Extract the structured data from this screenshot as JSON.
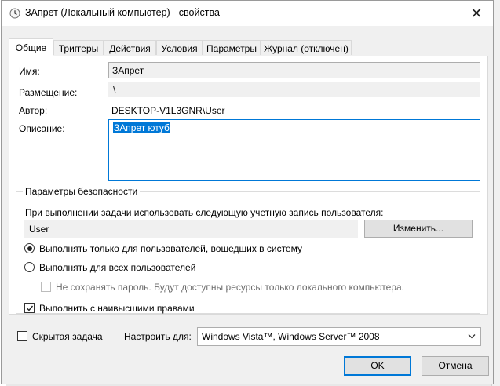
{
  "window": {
    "title": "ЗАпрет (Локальный компьютер) - свойства",
    "close_label": "✕"
  },
  "tabs": [
    {
      "label": "Общие",
      "active": true
    },
    {
      "label": "Триггеры"
    },
    {
      "label": "Действия"
    },
    {
      "label": "Условия"
    },
    {
      "label": "Параметры"
    },
    {
      "label": "Журнал (отключен)"
    }
  ],
  "general": {
    "name_label": "Имя:",
    "name_value": "ЗАпрет",
    "location_label": "Размещение:",
    "location_value": "\\",
    "author_label": "Автор:",
    "author_value": "DESKTOP-V1L3GNR\\User",
    "description_label": "Описание:",
    "description_value": "ЗАпрет ютуб"
  },
  "security": {
    "title": "Параметры безопасности",
    "account_prompt": "При выполнении задачи использовать следующую учетную запись пользователя:",
    "account_value": "User",
    "change_button": "Изменить...",
    "radio_logged_on": "Выполнять только для пользователей, вошедших в систему",
    "radio_all_users": "Выполнять для всех пользователей",
    "no_store_password": "Не сохранять пароль. Будут доступны ресурсы только локального компьютера.",
    "highest_privileges": "Выполнить с наивысшими правами"
  },
  "bottom": {
    "hidden_task": "Скрытая задача",
    "configure_for_label": "Настроить для:",
    "configure_for_value": "Windows Vista™, Windows Server™ 2008"
  },
  "buttons": {
    "ok": "OK",
    "cancel": "Отмена"
  }
}
